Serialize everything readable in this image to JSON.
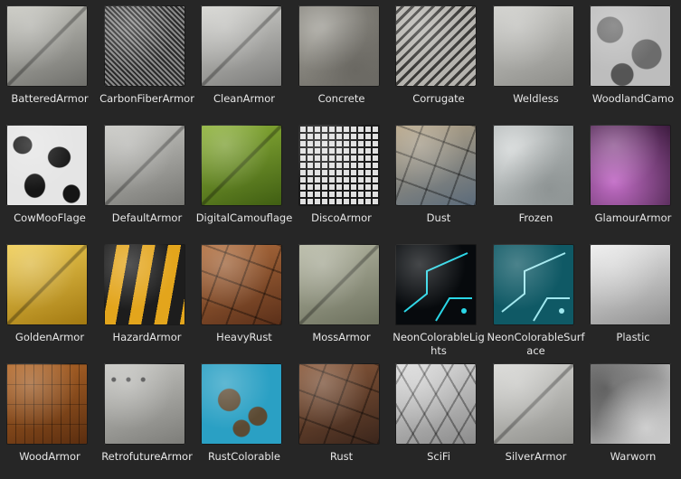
{
  "materials": [
    {
      "name": "BatteredArmor",
      "style": "plate",
      "c1": "#c9c9c2",
      "c2": "#6e6e6a"
    },
    {
      "name": "CarbonFiberArmor",
      "style": "mesh",
      "c1": "#8a8a8a",
      "c2": "#2a2a2a"
    },
    {
      "name": "CleanArmor",
      "style": "plate",
      "c1": "#d6d6d2",
      "c2": "#7a7a78"
    },
    {
      "name": "Concrete",
      "style": "rough",
      "c1": "#9c9a92",
      "c2": "#6a6862"
    },
    {
      "name": "Corrugate",
      "style": "stripes",
      "c1": "#b5b3ae",
      "c2": "#3a3937"
    },
    {
      "name": "Weldless",
      "style": "smooth",
      "c1": "#cfcfcb",
      "c2": "#8c8c88"
    },
    {
      "name": "WoodlandCamo",
      "style": "camo",
      "c1": "#bdbdbd",
      "c2": "#6c6c6c"
    },
    {
      "name": "CowMooFlage",
      "style": "cow",
      "c1": "#e5e5e5",
      "c2": "#151515"
    },
    {
      "name": "DefaultArmor",
      "style": "plate",
      "c1": "#cacac6",
      "c2": "#767672"
    },
    {
      "name": "DigitalCamouflage",
      "style": "plate",
      "c1": "#8fb43a",
      "c2": "#3f5d12"
    },
    {
      "name": "DiscoArmor",
      "style": "disco",
      "c1": "#e0e0e0",
      "c2": "#1a1a1a"
    },
    {
      "name": "Dust",
      "style": "tiles",
      "c1": "#b7a586",
      "c2": "#5a6a7a"
    },
    {
      "name": "Frozen",
      "style": "rough",
      "c1": "#cfd3d3",
      "c2": "#8e9494"
    },
    {
      "name": "GlamourArmor",
      "style": "glitter",
      "c1": "#c46fc8",
      "c2": "#3a1a3c"
    },
    {
      "name": "GoldenArmor",
      "style": "plate",
      "c1": "#f1cf55",
      "c2": "#a27810"
    },
    {
      "name": "HazardArmor",
      "style": "hazard",
      "c1": "#e3a51c",
      "c2": "#1d1d1d"
    },
    {
      "name": "HeavyRust",
      "style": "tiles",
      "c1": "#b3703f",
      "c2": "#5a2f19"
    },
    {
      "name": "MossArmor",
      "style": "plate",
      "c1": "#b7b9a5",
      "c2": "#6b6f5c"
    },
    {
      "name": "NeonColorableLights",
      "style": "neon",
      "c1": "#2ad6e6",
      "c2": "#070a0d"
    },
    {
      "name": "NeonColorableSurface",
      "style": "neon",
      "c1": "#9fe7ee",
      "c2": "#0f5965"
    },
    {
      "name": "Plastic",
      "style": "smooth",
      "c1": "#efefef",
      "c2": "#8f8f8f"
    },
    {
      "name": "WoodArmor",
      "style": "wood",
      "c1": "#b66a2a",
      "c2": "#5a2d0f"
    },
    {
      "name": "RetrofutureArmor",
      "style": "rivet",
      "c1": "#c8c8c4",
      "c2": "#7c7c78"
    },
    {
      "name": "RustColorable",
      "style": "rustblue",
      "c1": "#2aa0c4",
      "c2": "#5b4a33"
    },
    {
      "name": "Rust",
      "style": "tiles",
      "c1": "#8b5a3b",
      "c2": "#3a251b"
    },
    {
      "name": "SciFi",
      "style": "hex",
      "c1": "#dedede",
      "c2": "#8a8a8a"
    },
    {
      "name": "SilverArmor",
      "style": "plate",
      "c1": "#d9d9d6",
      "c2": "#8f8f8b"
    },
    {
      "name": "Warworn",
      "style": "rough",
      "c1": "#3b3b3b",
      "c2": "#cfcfcf"
    }
  ]
}
